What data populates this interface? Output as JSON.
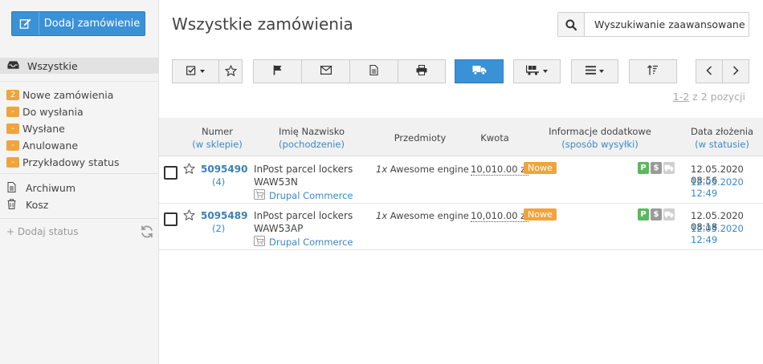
{
  "sidebar": {
    "add_order_label": "Dodaj zamówienie",
    "all_label": "Wszystkie",
    "statuses": [
      {
        "badge": "2",
        "label": "Nowe zamówienia"
      },
      {
        "badge": "-",
        "label": "Do wysłania"
      },
      {
        "badge": "-",
        "label": "Wysłane"
      },
      {
        "badge": "-",
        "label": "Anulowane"
      },
      {
        "badge": "-",
        "label": "Przykładowy status"
      }
    ],
    "archive_label": "Archiwum",
    "trash_label": "Kosz",
    "add_status_label": "+ Dodaj status"
  },
  "main": {
    "title": "Wszystkie zamówienia",
    "search_label": "Wyszukiwanie zaawansowane",
    "pagination": {
      "range": "1-2",
      "rest": " z 2 pozycji"
    }
  },
  "table": {
    "headers": [
      {
        "title": "Numer",
        "sub": "(w sklepie)"
      },
      {
        "title": "Imię Nazwisko",
        "sub": "(pochodzenie)"
      },
      {
        "title": "Przedmioty",
        "sub": ""
      },
      {
        "title": "Kwota",
        "sub": ""
      },
      {
        "title": "Informacje dodatkowe",
        "sub": "(sposób wysyłki)"
      },
      {
        "title": "Data złożenia",
        "sub": "(w statusie)"
      }
    ],
    "rows": [
      {
        "number": "5095490",
        "count": "(4)",
        "delivery": "InPost parcel lockers",
        "point": "WAW53N",
        "source": "Drupal Commerce",
        "qty": "1x",
        "product": " Awesome engine",
        "amount": "10,010.00 zł",
        "status": "Nowe",
        "flag_p": "P",
        "flag_s": "$",
        "date_created": "12.05.2020 08:56",
        "date_status": "12.05.2020 12:49"
      },
      {
        "number": "5095489",
        "count": "(2)",
        "delivery": "InPost parcel lockers",
        "point": "WAW53AP",
        "source": "Drupal Commerce",
        "qty": "1x",
        "product": " Awesome engine",
        "amount": "10,010.00 zł",
        "status": "Nowe",
        "flag_p": "P",
        "flag_s": "$",
        "date_created": "12.05.2020 08:18",
        "date_status": "12.05.2020 12:49"
      }
    ]
  },
  "colors": {
    "accent": "#3a91d6",
    "badge": "#f0a43b",
    "link": "#3a88c8",
    "paid": "#5cb85c"
  }
}
